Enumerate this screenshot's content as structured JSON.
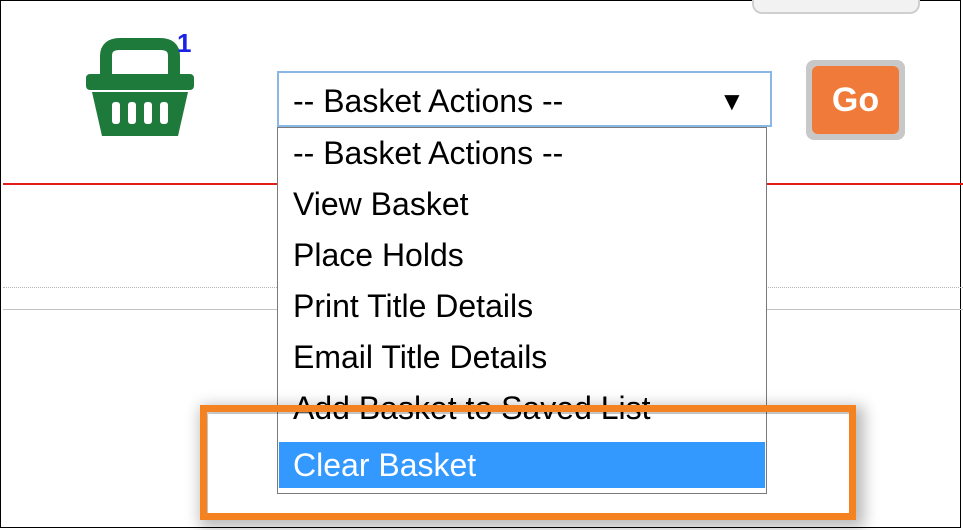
{
  "basket": {
    "icon": "basket-icon",
    "count": "1",
    "color": "#1e7a3a"
  },
  "actions_select": {
    "selected_value": "-- Basket Actions --",
    "arrow": "▼"
  },
  "dropdown": {
    "options": [
      "-- Basket Actions --",
      "View Basket",
      "Place Holds",
      "Print Title Details",
      "Email Title Details",
      "Add Basket to Saved List",
      "Clear Basket"
    ],
    "highlighted_index": 6,
    "highlight_color": "#3399ff"
  },
  "go_button": {
    "label": "Go",
    "color": "#f07a3a"
  },
  "annotation": {
    "highlight_color": "#f58220"
  }
}
